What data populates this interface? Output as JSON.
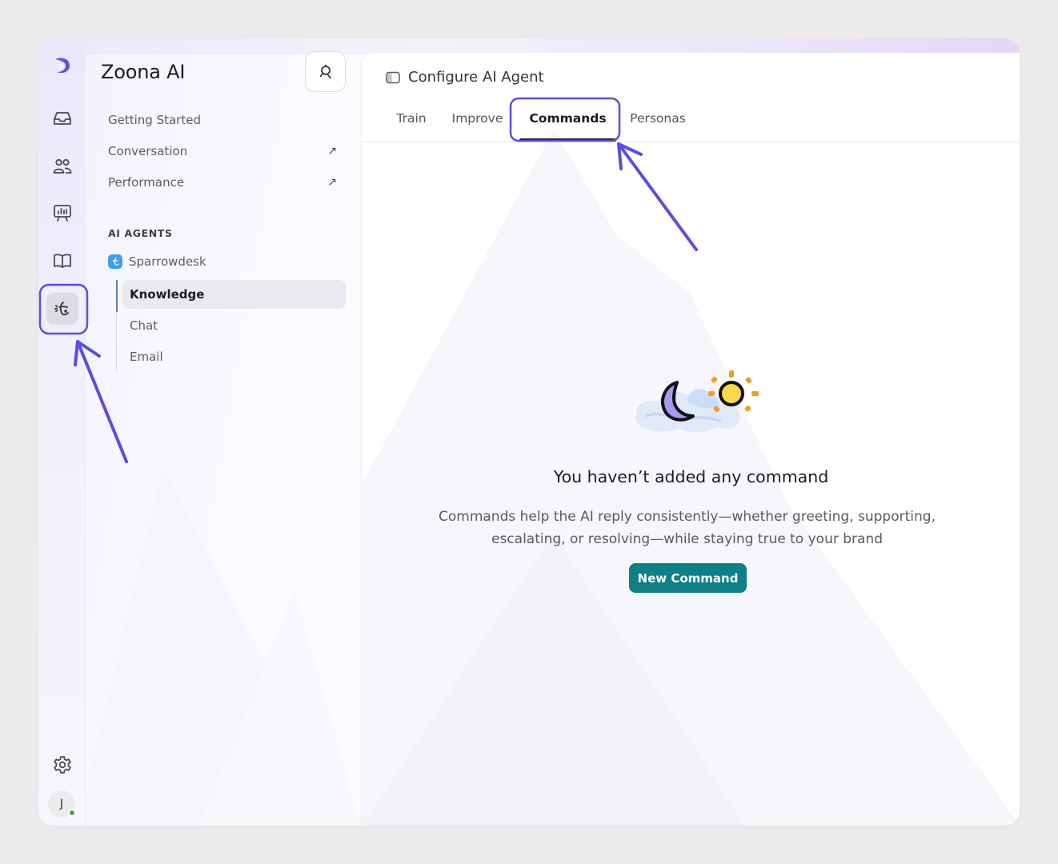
{
  "app": {
    "name": "Zoona AI"
  },
  "rail": {
    "avatar_initial": "J"
  },
  "nav": {
    "items": [
      {
        "label": "Getting Started",
        "external": false
      },
      {
        "label": "Conversation",
        "external": true
      },
      {
        "label": "Performance",
        "external": true
      }
    ],
    "external_glyph": "↗",
    "section_label": "AI AGENTS",
    "agent": {
      "name": "Sparrowdesk",
      "children": [
        {
          "label": "Knowledge",
          "active": true
        },
        {
          "label": "Chat",
          "active": false
        },
        {
          "label": "Email",
          "active": false
        }
      ]
    }
  },
  "main": {
    "title": "Configure AI Agent",
    "tabs": [
      {
        "label": "Train",
        "active": false
      },
      {
        "label": "Improve",
        "active": false
      },
      {
        "label": "Commands",
        "active": true
      },
      {
        "label": "Personas",
        "active": false
      }
    ],
    "empty_state": {
      "title": "You haven’t added any command",
      "description_line1": "Commands help the AI reply consistently—whether greeting, supporting,",
      "description_line2": "escalating, or resolving—while staying true to your brand",
      "button_label": "New Command"
    }
  },
  "colors": {
    "accent": "#0d7f86",
    "annotation": "#5a4ee0",
    "agent_badge": "#3d9df0",
    "presence": "#4ca54d"
  },
  "icons": {
    "rail": [
      "logo-icon",
      "inbox-icon",
      "contacts-icon",
      "reports-icon",
      "knowledge-base-icon",
      "ai-agent-icon",
      "settings-icon"
    ],
    "search_button": "search-agent-icon",
    "title": "sidebar-toggle-icon"
  }
}
